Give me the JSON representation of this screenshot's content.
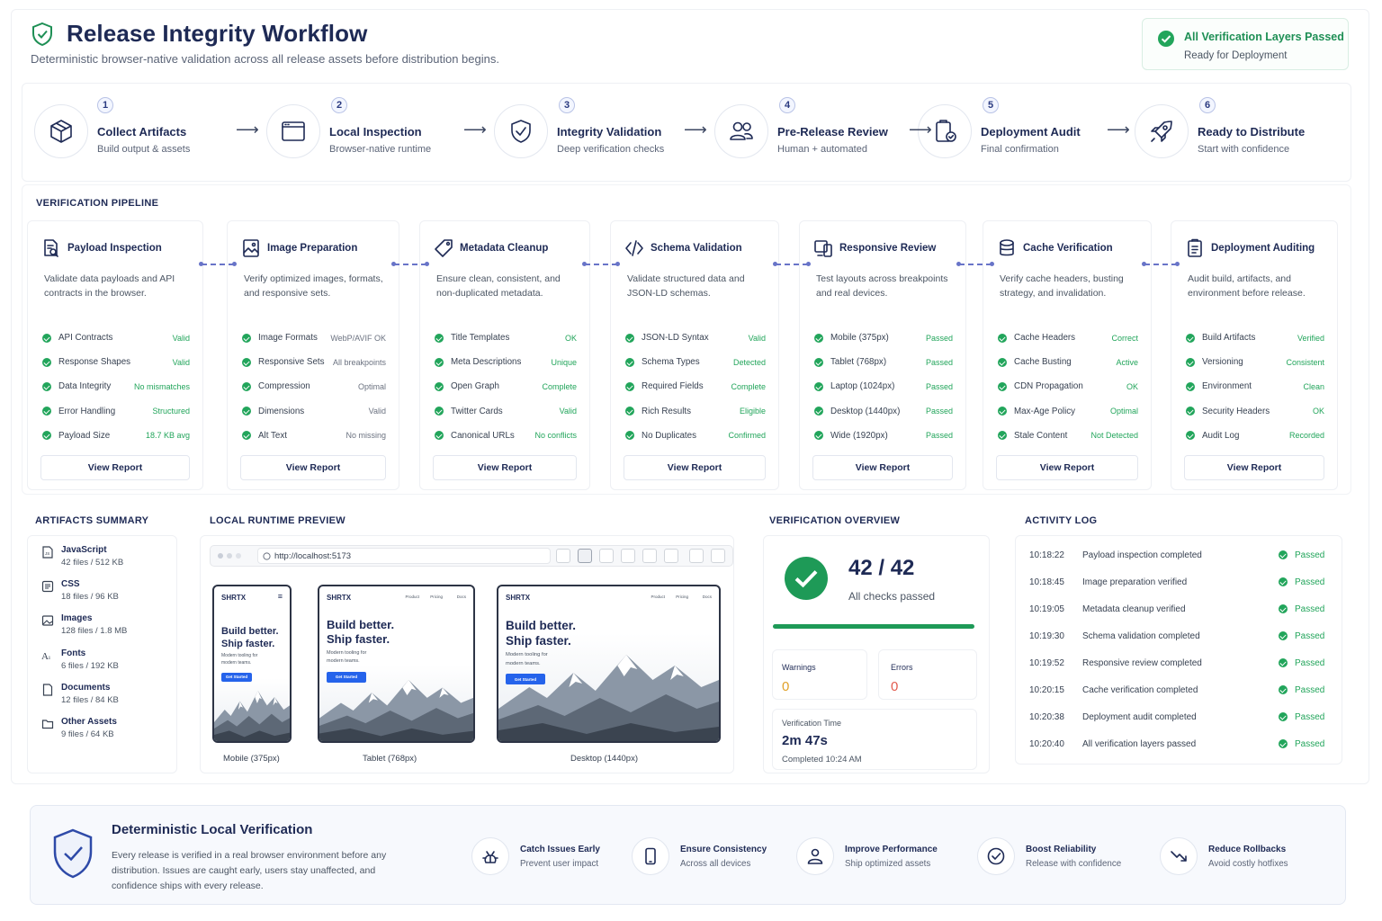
{
  "header": {
    "title": "Release Integrity Workflow",
    "subtitle": "Deterministic browser-native validation across all release assets before distribution begins.",
    "status_title": "All Verification Layers Passed",
    "status_sub": "Ready for Deployment"
  },
  "steps": [
    {
      "num": "1",
      "title": "Collect Artifacts",
      "sub": "Build output & assets",
      "icon": "box-icon"
    },
    {
      "num": "2",
      "title": "Local Inspection",
      "sub": "Browser-native runtime",
      "icon": "browser-window-icon"
    },
    {
      "num": "3",
      "title": "Integrity Validation",
      "sub": "Deep verification checks",
      "icon": "shield-check-icon"
    },
    {
      "num": "4",
      "title": "Pre-Release Review",
      "sub": "Human + automated",
      "icon": "users-icon"
    },
    {
      "num": "5",
      "title": "Deployment Audit",
      "sub": "Final confirmation",
      "icon": "clipboard-check-icon"
    },
    {
      "num": "6",
      "title": "Ready to Distribute",
      "sub": "Start with confidence",
      "icon": "rocket-icon"
    }
  ],
  "pipeline": {
    "label": "VERIFICATION PIPELINE",
    "button_label": "View Report",
    "cards": [
      {
        "title": "Payload Inspection",
        "desc": "Validate data payloads and API contracts in the browser.",
        "icon": "document-search-icon",
        "rows": [
          [
            "API Contracts",
            "Valid",
            "g"
          ],
          [
            "Response Shapes",
            "Valid",
            "g"
          ],
          [
            "Data Integrity",
            "No mismatches",
            "g"
          ],
          [
            "Error Handling",
            "Structured",
            "g"
          ],
          [
            "Payload Size",
            "18.7 KB avg",
            "g"
          ]
        ]
      },
      {
        "title": "Image Preparation",
        "desc": "Verify optimized images, formats, and responsive sets.",
        "icon": "image-icon",
        "rows": [
          [
            "Image Formats",
            "WebP/AVIF OK",
            "gr"
          ],
          [
            "Responsive Sets",
            "All breakpoints",
            "gr"
          ],
          [
            "Compression",
            "Optimal",
            "gr"
          ],
          [
            "Dimensions",
            "Valid",
            "gr"
          ],
          [
            "Alt Text",
            "No missing",
            "gr"
          ]
        ]
      },
      {
        "title": "Metadata Cleanup",
        "desc": "Ensure clean, consistent, and non-duplicated metadata.",
        "icon": "tag-icon",
        "rows": [
          [
            "Title Templates",
            "OK",
            "g"
          ],
          [
            "Meta Descriptions",
            "Unique",
            "g"
          ],
          [
            "Open Graph",
            "Complete",
            "g"
          ],
          [
            "Twitter Cards",
            "Valid",
            "g"
          ],
          [
            "Canonical URLs",
            "No conflicts",
            "g"
          ]
        ]
      },
      {
        "title": "Schema Validation",
        "desc": "Validate structured data and JSON-LD schemas.",
        "icon": "code-icon",
        "rows": [
          [
            "JSON-LD Syntax",
            "Valid",
            "g"
          ],
          [
            "Schema Types",
            "Detected",
            "g"
          ],
          [
            "Required Fields",
            "Complete",
            "g"
          ],
          [
            "Rich Results",
            "Eligible",
            "g"
          ],
          [
            "No Duplicates",
            "Confirmed",
            "g"
          ]
        ]
      },
      {
        "title": "Responsive Review",
        "desc": "Test layouts across breakpoints and real devices.",
        "icon": "devices-icon",
        "rows": [
          [
            "Mobile (375px)",
            "Passed",
            "g"
          ],
          [
            "Tablet (768px)",
            "Passed",
            "g"
          ],
          [
            "Laptop (1024px)",
            "Passed",
            "g"
          ],
          [
            "Desktop (1440px)",
            "Passed",
            "g"
          ],
          [
            "Wide (1920px)",
            "Passed",
            "g"
          ]
        ]
      },
      {
        "title": "Cache Verification",
        "desc": "Verify cache headers, busting strategy, and invalidation.",
        "icon": "database-icon",
        "rows": [
          [
            "Cache Headers",
            "Correct",
            "g"
          ],
          [
            "Cache Busting",
            "Active",
            "g"
          ],
          [
            "CDN Propagation",
            "OK",
            "g"
          ],
          [
            "Max-Age Policy",
            "Optimal",
            "g"
          ],
          [
            "Stale Content",
            "Not Detected",
            "g"
          ]
        ]
      },
      {
        "title": "Deployment Auditing",
        "desc": "Audit build, artifacts, and environment before release.",
        "icon": "clipboard-list-icon",
        "rows": [
          [
            "Build Artifacts",
            "Verified",
            "g"
          ],
          [
            "Versioning",
            "Consistent",
            "g"
          ],
          [
            "Environment",
            "Clean",
            "g"
          ],
          [
            "Security Headers",
            "OK",
            "g"
          ],
          [
            "Audit Log",
            "Recorded",
            "g"
          ]
        ]
      }
    ]
  },
  "artifacts": {
    "label": "ARTIFACTS SUMMARY",
    "items": [
      {
        "name": "JavaScript",
        "detail": "42 files / 512 KB",
        "icon": "js-file-icon"
      },
      {
        "name": "CSS",
        "detail": "18 files / 96 KB",
        "icon": "css-file-icon"
      },
      {
        "name": "Images",
        "detail": "128 files / 1.8 MB",
        "icon": "image-file-icon"
      },
      {
        "name": "Fonts",
        "detail": "6 files / 192 KB",
        "icon": "font-icon"
      },
      {
        "name": "Documents",
        "detail": "12 files / 84 KB",
        "icon": "document-icon"
      },
      {
        "name": "Other Assets",
        "detail": "9 files / 64 KB",
        "icon": "folder-icon"
      }
    ]
  },
  "preview": {
    "label": "LOCAL RUNTIME PREVIEW",
    "url": "http://localhost:5173",
    "brand": "SHRTX",
    "headline_1": "Build better.",
    "headline_2": "Ship faster.",
    "tagline_1": "Modern tooling for",
    "tagline_2": "modern teams.",
    "cta": "Get Started",
    "nav": [
      "Product",
      "Pricing",
      "Docs"
    ],
    "captions": [
      "Mobile (375px)",
      "Tablet (768px)",
      "Desktop (1440px)"
    ]
  },
  "overview": {
    "label": "VERIFICATION OVERVIEW",
    "score": "42 / 42",
    "score_sub": "All checks passed",
    "progress": 1.0,
    "warnings_label": "Warnings",
    "warnings": "0",
    "errors_label": "Errors",
    "errors": "0",
    "time_label": "Verification Time",
    "time": "2m 47s",
    "completed": "Completed 10:24 AM"
  },
  "activity": {
    "label": "ACTIVITY LOG",
    "entries": [
      [
        "10:18:22",
        "Payload inspection completed",
        "Passed"
      ],
      [
        "10:18:45",
        "Image preparation verified",
        "Passed"
      ],
      [
        "10:19:05",
        "Metadata cleanup verified",
        "Passed"
      ],
      [
        "10:19:30",
        "Schema validation completed",
        "Passed"
      ],
      [
        "10:19:52",
        "Responsive review completed",
        "Passed"
      ],
      [
        "10:20:15",
        "Cache verification completed",
        "Passed"
      ],
      [
        "10:20:38",
        "Deployment audit completed",
        "Passed"
      ],
      [
        "10:20:40",
        "All verification layers passed",
        "Passed"
      ]
    ]
  },
  "footer": {
    "title": "Deterministic Local Verification",
    "text_1": "Every release is verified in a real browser environment before any",
    "text_2": "distribution. Issues are caught early, users stay unaffected, and",
    "text_3": "confidence ships with every release.",
    "benefits": [
      {
        "title": "Catch Issues Early",
        "sub": "Prevent user impact",
        "icon": "bug-icon"
      },
      {
        "title": "Ensure Consistency",
        "sub": "Across all devices",
        "icon": "phone-icon"
      },
      {
        "title": "Improve Performance",
        "sub": "Ship optimized assets",
        "icon": "user-gauge-icon"
      },
      {
        "title": "Boost Reliability",
        "sub": "Release with confidence",
        "icon": "check-badge-icon"
      },
      {
        "title": "Reduce Rollbacks",
        "sub": "Avoid costly hotfixes",
        "icon": "trend-down-icon"
      }
    ]
  },
  "colors": {
    "navy": "#1e2a55",
    "green": "#22a55b",
    "warning": "#e0a12a",
    "error": "#e25c4f",
    "accent": "#2563eb"
  }
}
